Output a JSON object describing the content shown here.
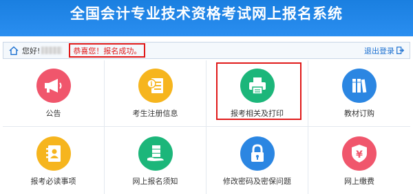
{
  "header": {
    "title": "全国会计专业技术资格考试网上报名系统"
  },
  "infobar": {
    "greeting": "您好!",
    "success_message": "恭喜您！报名成功。",
    "logout_label": "退出登录"
  },
  "tiles": [
    {
      "label": "公告",
      "icon": "megaphone-icon",
      "color": "#f0566c"
    },
    {
      "label": "考生注册信息",
      "icon": "registration-info-icon",
      "color": "#f6b51e"
    },
    {
      "label": "报考相关及打印",
      "icon": "printer-icon",
      "color": "#1cb67a"
    },
    {
      "label": "教材订购",
      "icon": "books-icon",
      "color": "#2b86e2"
    },
    {
      "label": "报考必读事项",
      "icon": "contact-book-icon",
      "color": "#f6b51e"
    },
    {
      "label": "网上报名须知",
      "icon": "hand-server-icon",
      "color": "#1cb67a"
    },
    {
      "label": "修改密码及密保问题",
      "icon": "lock-icon",
      "color": "#2b86e2"
    },
    {
      "label": "网上缴费",
      "icon": "yen-shield-icon",
      "color": "#f0566c"
    }
  ],
  "colors": {
    "header_blue": "#1a7fe0",
    "alert_red": "#e01818",
    "link_blue": "#1a6fd0"
  }
}
